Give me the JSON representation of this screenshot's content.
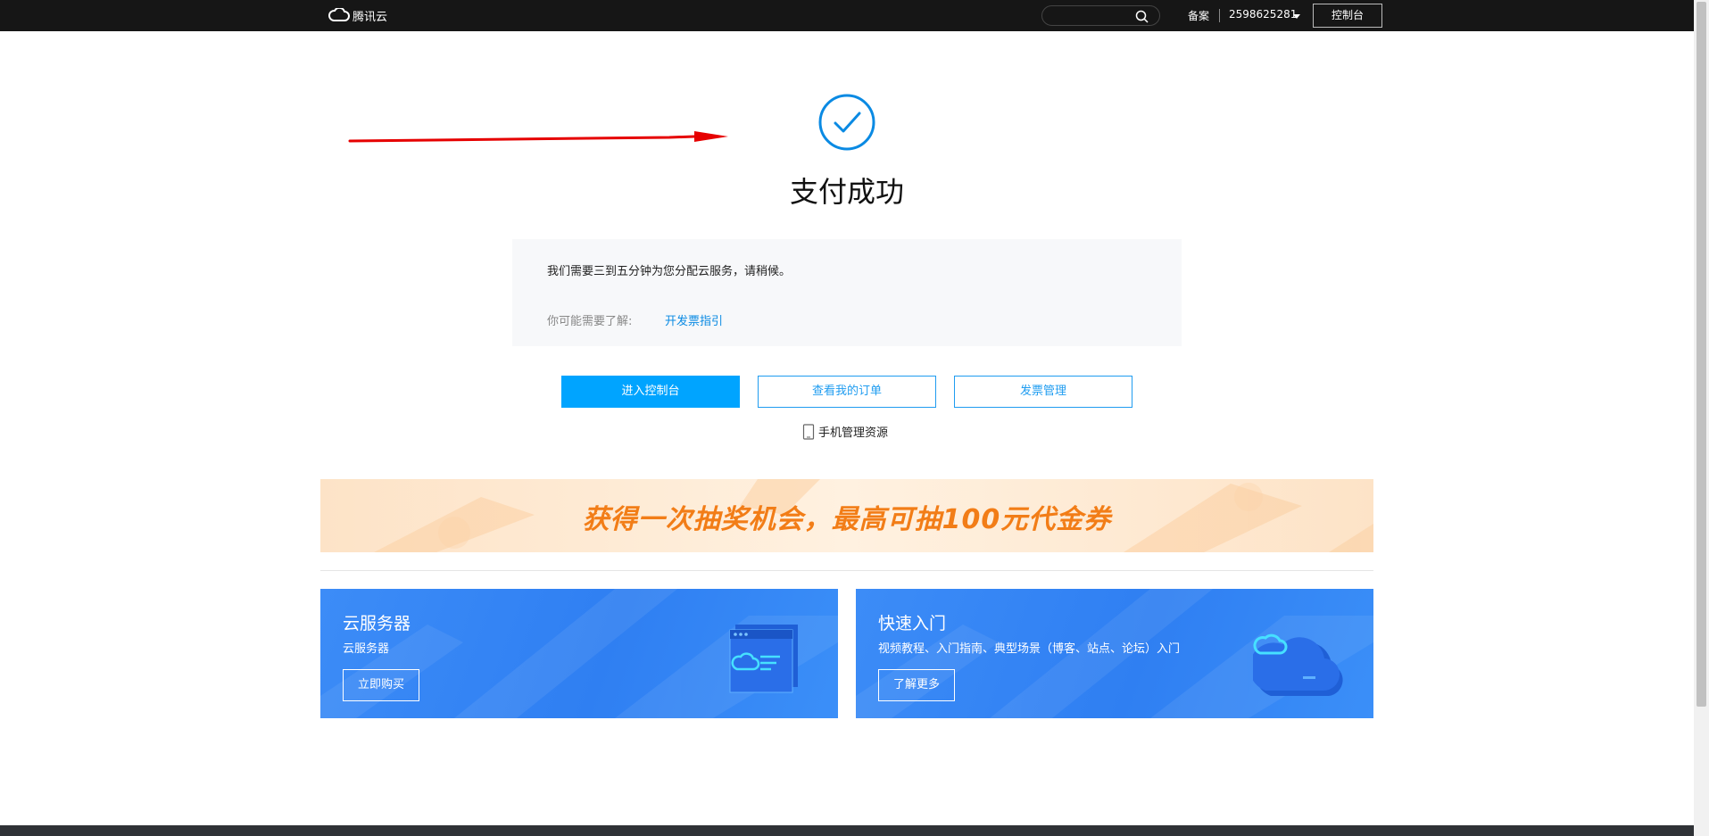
{
  "topbar": {
    "logo_text": "腾讯云",
    "search_placeholder": "",
    "beian": "备案",
    "account": "2598625281",
    "console_button": "控制台"
  },
  "success": {
    "title": "支付成功"
  },
  "info": {
    "message": "我们需要三到五分钟为您分配云服务，请稍候。",
    "hint_label": "你可能需要了解:",
    "hint_link": "开发票指引"
  },
  "actions": {
    "enter_console": "进入控制台",
    "view_orders": "查看我的订单",
    "invoice_manage": "发票管理",
    "mobile_manage": "手机管理资源"
  },
  "banner": {
    "text": "获得一次抽奖机会，最高可抽100元代金券"
  },
  "cards": [
    {
      "title": "云服务器",
      "subtitle": "云服务器",
      "button": "立即购买"
    },
    {
      "title": "快速入门",
      "subtitle": "视频教程、入门指南、典型场景（博客、站点、论坛）入门",
      "button": "了解更多"
    }
  ],
  "colors": {
    "topbar": "#161616",
    "accent": "#00a4ff",
    "link": "#0a8ae3",
    "banner_text": "#f27d17",
    "card_blue": "#2f7ff2",
    "annotation": "#e60000"
  }
}
